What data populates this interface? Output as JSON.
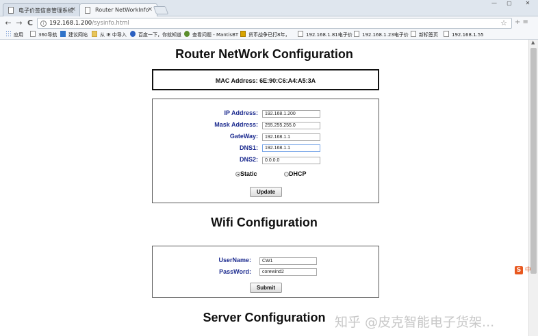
{
  "tabs": [
    {
      "title": "电子价签信息管理系统",
      "close": "×"
    },
    {
      "title": "Router NetWorkInfo",
      "close": "×"
    }
  ],
  "window_controls": {
    "minimize": "—",
    "maximize": "▢",
    "close": "✕"
  },
  "toolbar": {
    "back": "←",
    "forward": "→",
    "reload": "C",
    "url_host": "192.168.1.200",
    "url_path": "/sysinfo.html",
    "star": "☆",
    "extra": "+ ≡"
  },
  "bookmarks": [
    {
      "label": "应用",
      "icon": "apps-icon"
    },
    {
      "label": "360导航",
      "icon": "page-icon"
    },
    {
      "label": "建议网站",
      "icon": "bing-icon"
    },
    {
      "label": "从 IE 中导入",
      "icon": "folder-icon"
    },
    {
      "label": "百度一下，你就知道",
      "icon": "baidu-paw-icon"
    },
    {
      "label": "查看问题 - MantisBT",
      "icon": "mantis-icon"
    },
    {
      "label": "货币战争已打8年，",
      "icon": "coin-icon"
    },
    {
      "label": "192.168.1.81电子价",
      "icon": "page-icon"
    },
    {
      "label": "192.168.1.23电子价",
      "icon": "page-icon"
    },
    {
      "label": "新标签页",
      "icon": "page-icon"
    },
    {
      "label": "192.168.1.55",
      "icon": "page-icon"
    }
  ],
  "page": {
    "router_title": "Router NetWork Configuration",
    "mac_line": "MAC Address: 6E:90:C6:A4:A5:3A",
    "network_fields": [
      {
        "label": "IP Address:",
        "value": "192.168.1.200"
      },
      {
        "label": "Mask Address:",
        "value": "255.255.255.0"
      },
      {
        "label": "GateWay:",
        "value": "192.168.1.1"
      },
      {
        "label": "DNS1:",
        "value": "192.168.1.1"
      },
      {
        "label": "DNS2:",
        "value": "0.0.0.0"
      }
    ],
    "mode_options": [
      {
        "label": "Static",
        "checked": true
      },
      {
        "label": "DHCP",
        "checked": false
      }
    ],
    "update_button": "Update",
    "wifi_title": "Wifi Configuration",
    "wifi_fields": [
      {
        "label": "UserName:",
        "value": "CW1"
      },
      {
        "label": "PassWord:",
        "value": "corewind2"
      }
    ],
    "submit_button": "Submit",
    "server_title": "Server Configuration"
  },
  "overlay": {
    "ime_logo": "S",
    "ime_mode": "中",
    "watermark": "知乎 @皮克智能电子货架..."
  },
  "colors": {
    "label_blue": "#1c2b8f",
    "tabstrip": "#dfe6ee"
  }
}
